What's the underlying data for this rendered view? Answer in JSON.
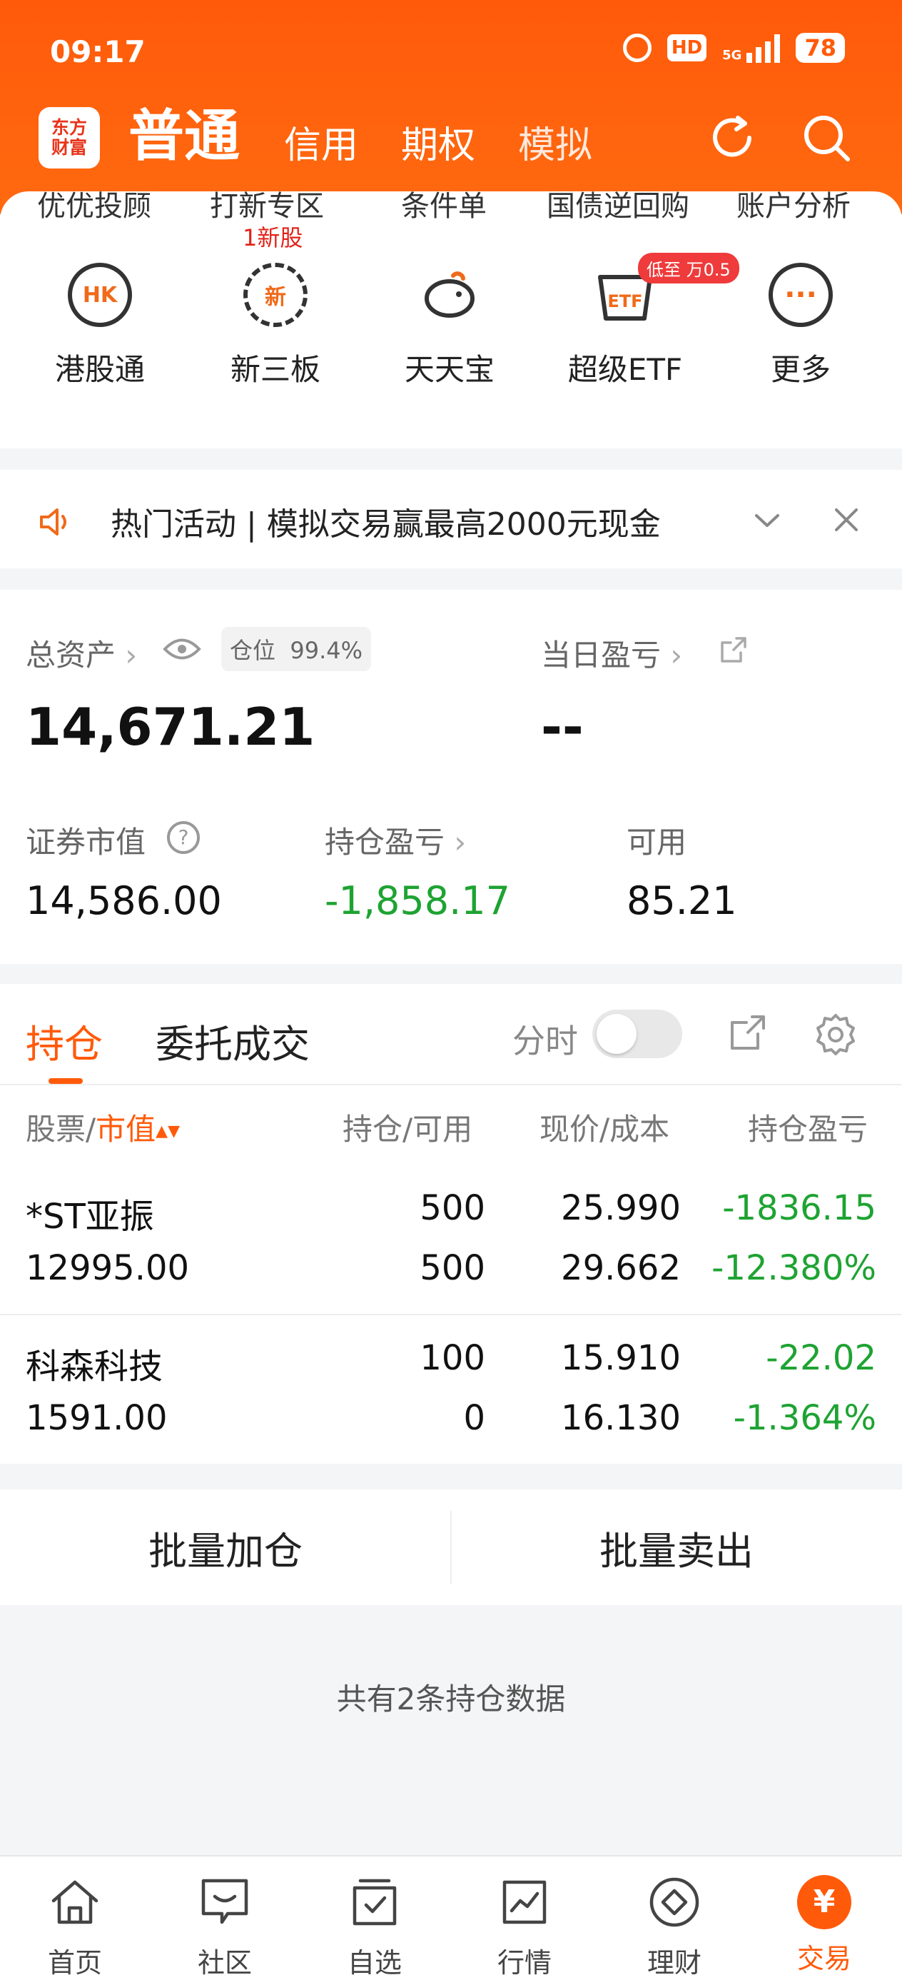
{
  "status_bar": {
    "time": "09:17",
    "hd": "HD",
    "network": "5G",
    "battery": "78"
  },
  "header": {
    "logo_line1": "东方",
    "logo_line2": "财富",
    "tabs": [
      {
        "label": "普通"
      },
      {
        "label": "信用"
      },
      {
        "label": "期权"
      },
      {
        "label": "模拟"
      }
    ],
    "active_tab": "普通",
    "icons": [
      "refresh-icon",
      "search-icon"
    ]
  },
  "menu": {
    "top_row": [
      "优优投顾",
      "打新专区",
      "条件单",
      "国债逆回购",
      "账户分析"
    ],
    "new_stock_tag": "1新股",
    "quick_items": [
      {
        "label": "港股通",
        "icon_text": "HK"
      },
      {
        "label": "新三板",
        "icon_text": "新"
      },
      {
        "label": "天天宝",
        "icon_text": "piggy"
      },
      {
        "label": "超级ETF",
        "icon_text": "ETF",
        "badge": "低至 万0.5"
      },
      {
        "label": "更多",
        "icon_text": "···"
      }
    ]
  },
  "notice": {
    "text": "热门活动 | 模拟交易赢最高2000元现金"
  },
  "assets": {
    "total_label": "总资产",
    "position_label": "仓位",
    "position_value": "99.4%",
    "total_value": "14,671.21",
    "daily_pl_label": "当日盈亏",
    "daily_pl_value": "--",
    "market_value_label": "证券市值",
    "market_value": "14,586.00",
    "holding_pl_label": "持仓盈亏",
    "holding_pl_value": "-1,858.17",
    "available_label": "可用",
    "available_value": "85.21"
  },
  "positions": {
    "tabs": [
      "持仓",
      "委托成交"
    ],
    "fenshi_label": "分时",
    "fenshi_on": false,
    "columns": {
      "stock": "股票/",
      "mv": "市值",
      "hold": "持仓/可用",
      "price": "现价/成本",
      "pl": "持仓盈亏"
    },
    "rows": [
      {
        "name": "*ST亚振",
        "market_value": "12995.00",
        "hold": "500",
        "available": "500",
        "price": "25.990",
        "cost": "29.662",
        "pl": "-1836.15",
        "pl_pct": "-12.380%"
      },
      {
        "name": "科森科技",
        "market_value": "1591.00",
        "hold": "100",
        "available": "0",
        "price": "15.910",
        "cost": "16.130",
        "pl": "-22.02",
        "pl_pct": "-1.364%"
      }
    ],
    "loss_color": "#1ea332"
  },
  "batch": {
    "add": "批量加仓",
    "sell": "批量卖出"
  },
  "count_text": "共有2条持仓数据",
  "bottom_nav": [
    {
      "label": "首页",
      "icon": "home-icon"
    },
    {
      "label": "社区",
      "icon": "community-icon"
    },
    {
      "label": "自选",
      "icon": "watchlist-icon"
    },
    {
      "label": "行情",
      "icon": "chart-icon"
    },
    {
      "label": "理财",
      "icon": "diamond-icon"
    },
    {
      "label": "交易",
      "icon": "trade-icon",
      "active": true
    }
  ],
  "accent_color": "#ff5a0a"
}
